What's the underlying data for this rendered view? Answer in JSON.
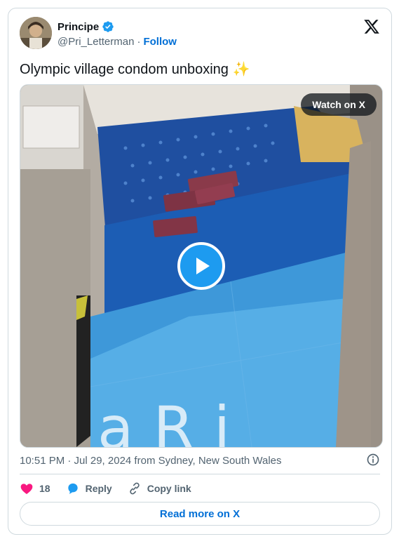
{
  "author": {
    "name": "Principe",
    "handle": "@Pri_Letterman",
    "separator": "·",
    "follow_label": "Follow"
  },
  "tweet": {
    "text": "Olympic village condom unboxing ✨"
  },
  "media": {
    "watch_label": "Watch on X",
    "overlay_text": "aRi"
  },
  "meta": {
    "timestamp": "10:51 PM · Jul 29, 2024 from Sydney, New South Wales"
  },
  "actions": {
    "likes_count": "18",
    "reply_label": "Reply",
    "copy_link_label": "Copy link"
  },
  "read_more_label": "Read more on X",
  "colors": {
    "accent": "#1d9bf0",
    "link": "#006fd6",
    "like": "#f91880",
    "text": "#0f1419",
    "muted": "#536471",
    "border": "#cfd9de"
  }
}
